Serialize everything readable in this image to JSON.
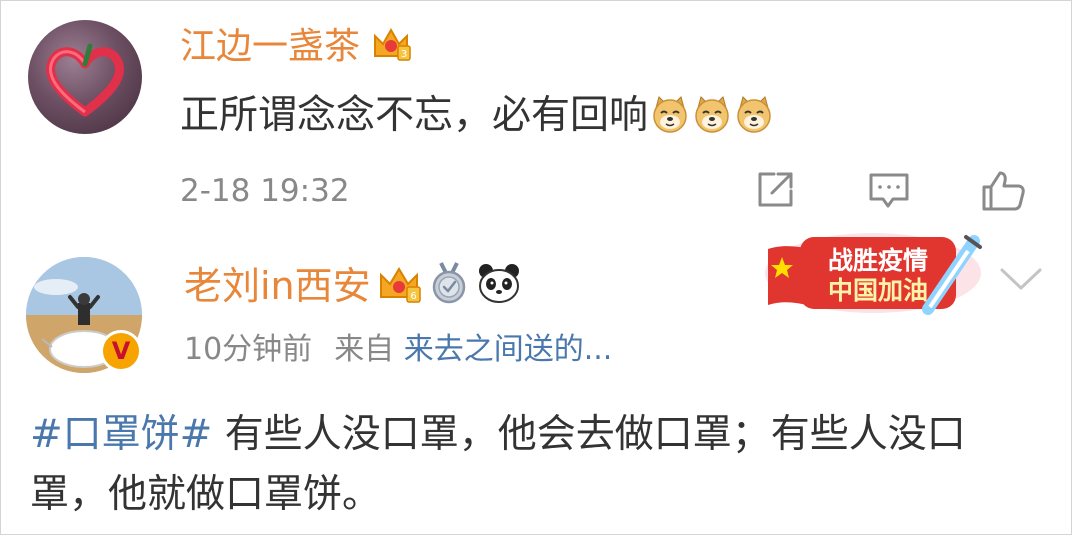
{
  "comment": {
    "username": "江边一盏茶",
    "text": "正所谓念念不忘，必有回响",
    "emoji_count": 3,
    "timestamp": "2-18 19:32",
    "badge_icon": "crown-level-icon",
    "actions": [
      "share-icon",
      "comment-icon",
      "like-icon"
    ]
  },
  "post": {
    "username": "老刘in西安",
    "time_ago": "10分钟前",
    "from_label": "来自",
    "source": "来去之间送的...",
    "hashtag": "#口罩饼#",
    "body": " 有些人没口罩，他会去做口罩；有些人没口罩，他就做口罩饼。",
    "verified_badge": "V",
    "banner": {
      "line1": "战胜疫情",
      "line2": "中国加油"
    },
    "icons": [
      "crown-level-icon",
      "medal-answer-icon",
      "panda-icon"
    ]
  },
  "colors": {
    "username": "#e8863a",
    "link": "#4a78ad",
    "meta": "#888888",
    "text": "#333333",
    "banner_red": "#e0362f"
  }
}
